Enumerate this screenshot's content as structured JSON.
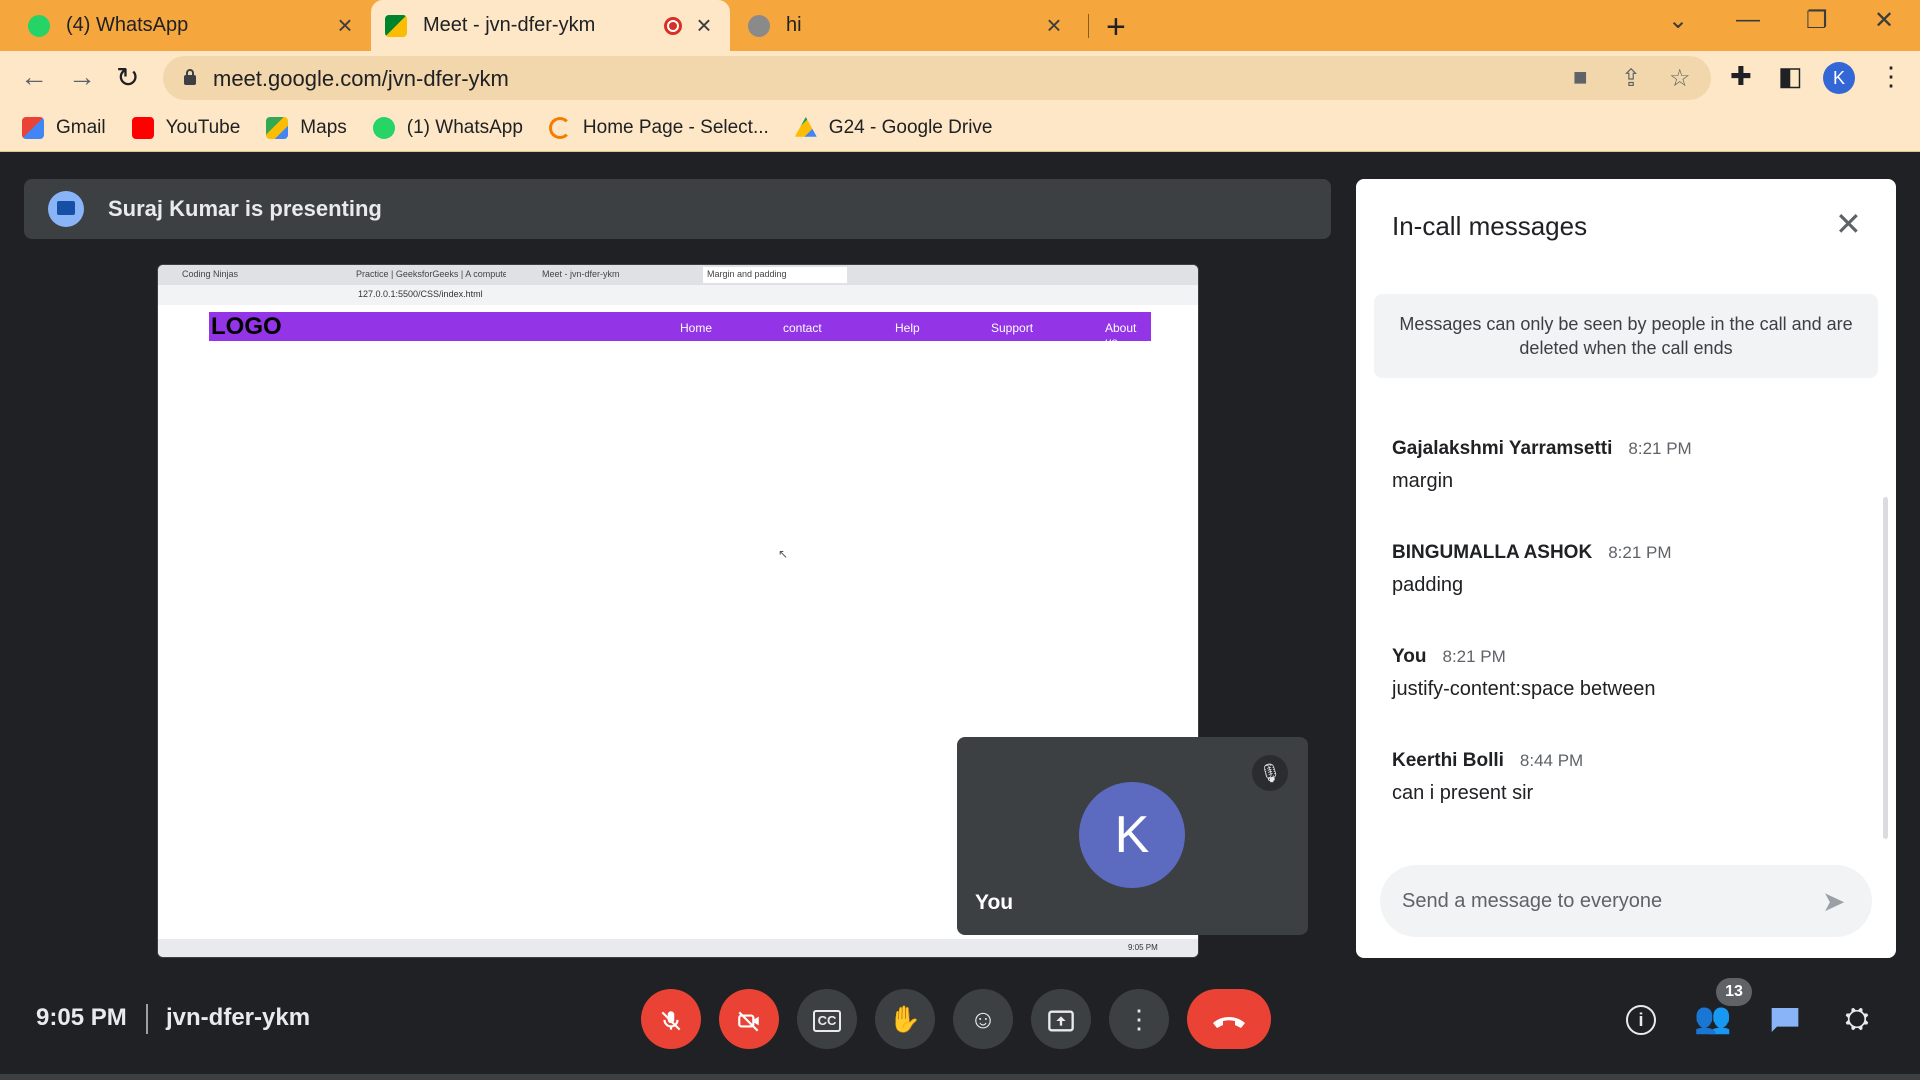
{
  "browser": {
    "tabs": [
      {
        "title": "(4) WhatsApp",
        "icon": "whatsapp-icon"
      },
      {
        "title": "Meet - jvn-dfer-ykm",
        "icon": "google-meet-icon",
        "active": true
      },
      {
        "title": "hi",
        "icon": "globe-icon"
      }
    ],
    "url": "meet.google.com/jvn-dfer-ykm",
    "profile_initial": "K",
    "bookmarks": [
      {
        "label": "Gmail",
        "icon": "gmail-icon"
      },
      {
        "label": "YouTube",
        "icon": "youtube-icon"
      },
      {
        "label": "Maps",
        "icon": "maps-icon"
      },
      {
        "label": "(1) WhatsApp",
        "icon": "whatsapp-icon"
      },
      {
        "label": "Home Page - Select...",
        "icon": "loading-icon"
      },
      {
        "label": "G24 - Google Drive",
        "icon": "google-drive-icon"
      }
    ]
  },
  "presentation": {
    "banner": "Suraj Kumar is presenting",
    "shared_screen": {
      "tabs": [
        "Coding Ninjas",
        "Practice | GeeksforGeeks | A computer...",
        "Meet - jvn-dfer-ykm",
        "Margin and padding"
      ],
      "url": "127.0.0.1:5500/CSS/index.html",
      "logo": "LOGO",
      "nav_links": [
        "Home",
        "contact",
        "Help",
        "Support",
        "About us"
      ],
      "clock": "9:05 PM"
    }
  },
  "self_view": {
    "initial": "K",
    "name": "You"
  },
  "chat": {
    "title": "In-call messages",
    "notice": "Messages can only be seen by people in the call and are deleted when the call ends",
    "messages": [
      {
        "sender": "Gajalakshmi Yarramsetti",
        "time": "8:21 PM",
        "text": "margin"
      },
      {
        "sender": "BINGUMALLA ASHOK",
        "time": "8:21 PM",
        "text": "padding"
      },
      {
        "sender": "You",
        "time": "8:21 PM",
        "text": "justify-content:space between"
      },
      {
        "sender": "Keerthi Bolli",
        "time": "8:44 PM",
        "text": "can i present sir"
      }
    ],
    "input_placeholder": "Send a message to everyone"
  },
  "meeting": {
    "time": "9:05 PM",
    "code": "jvn-dfer-ykm",
    "participant_count": "13"
  },
  "colors": {
    "tab_bar": "#f5a73e",
    "toolbar": "#fde7c6",
    "meet_bg": "#202124",
    "end_call": "#ea4335",
    "avatar": "#5c6bc0",
    "shared_nav": "#9334e6"
  }
}
